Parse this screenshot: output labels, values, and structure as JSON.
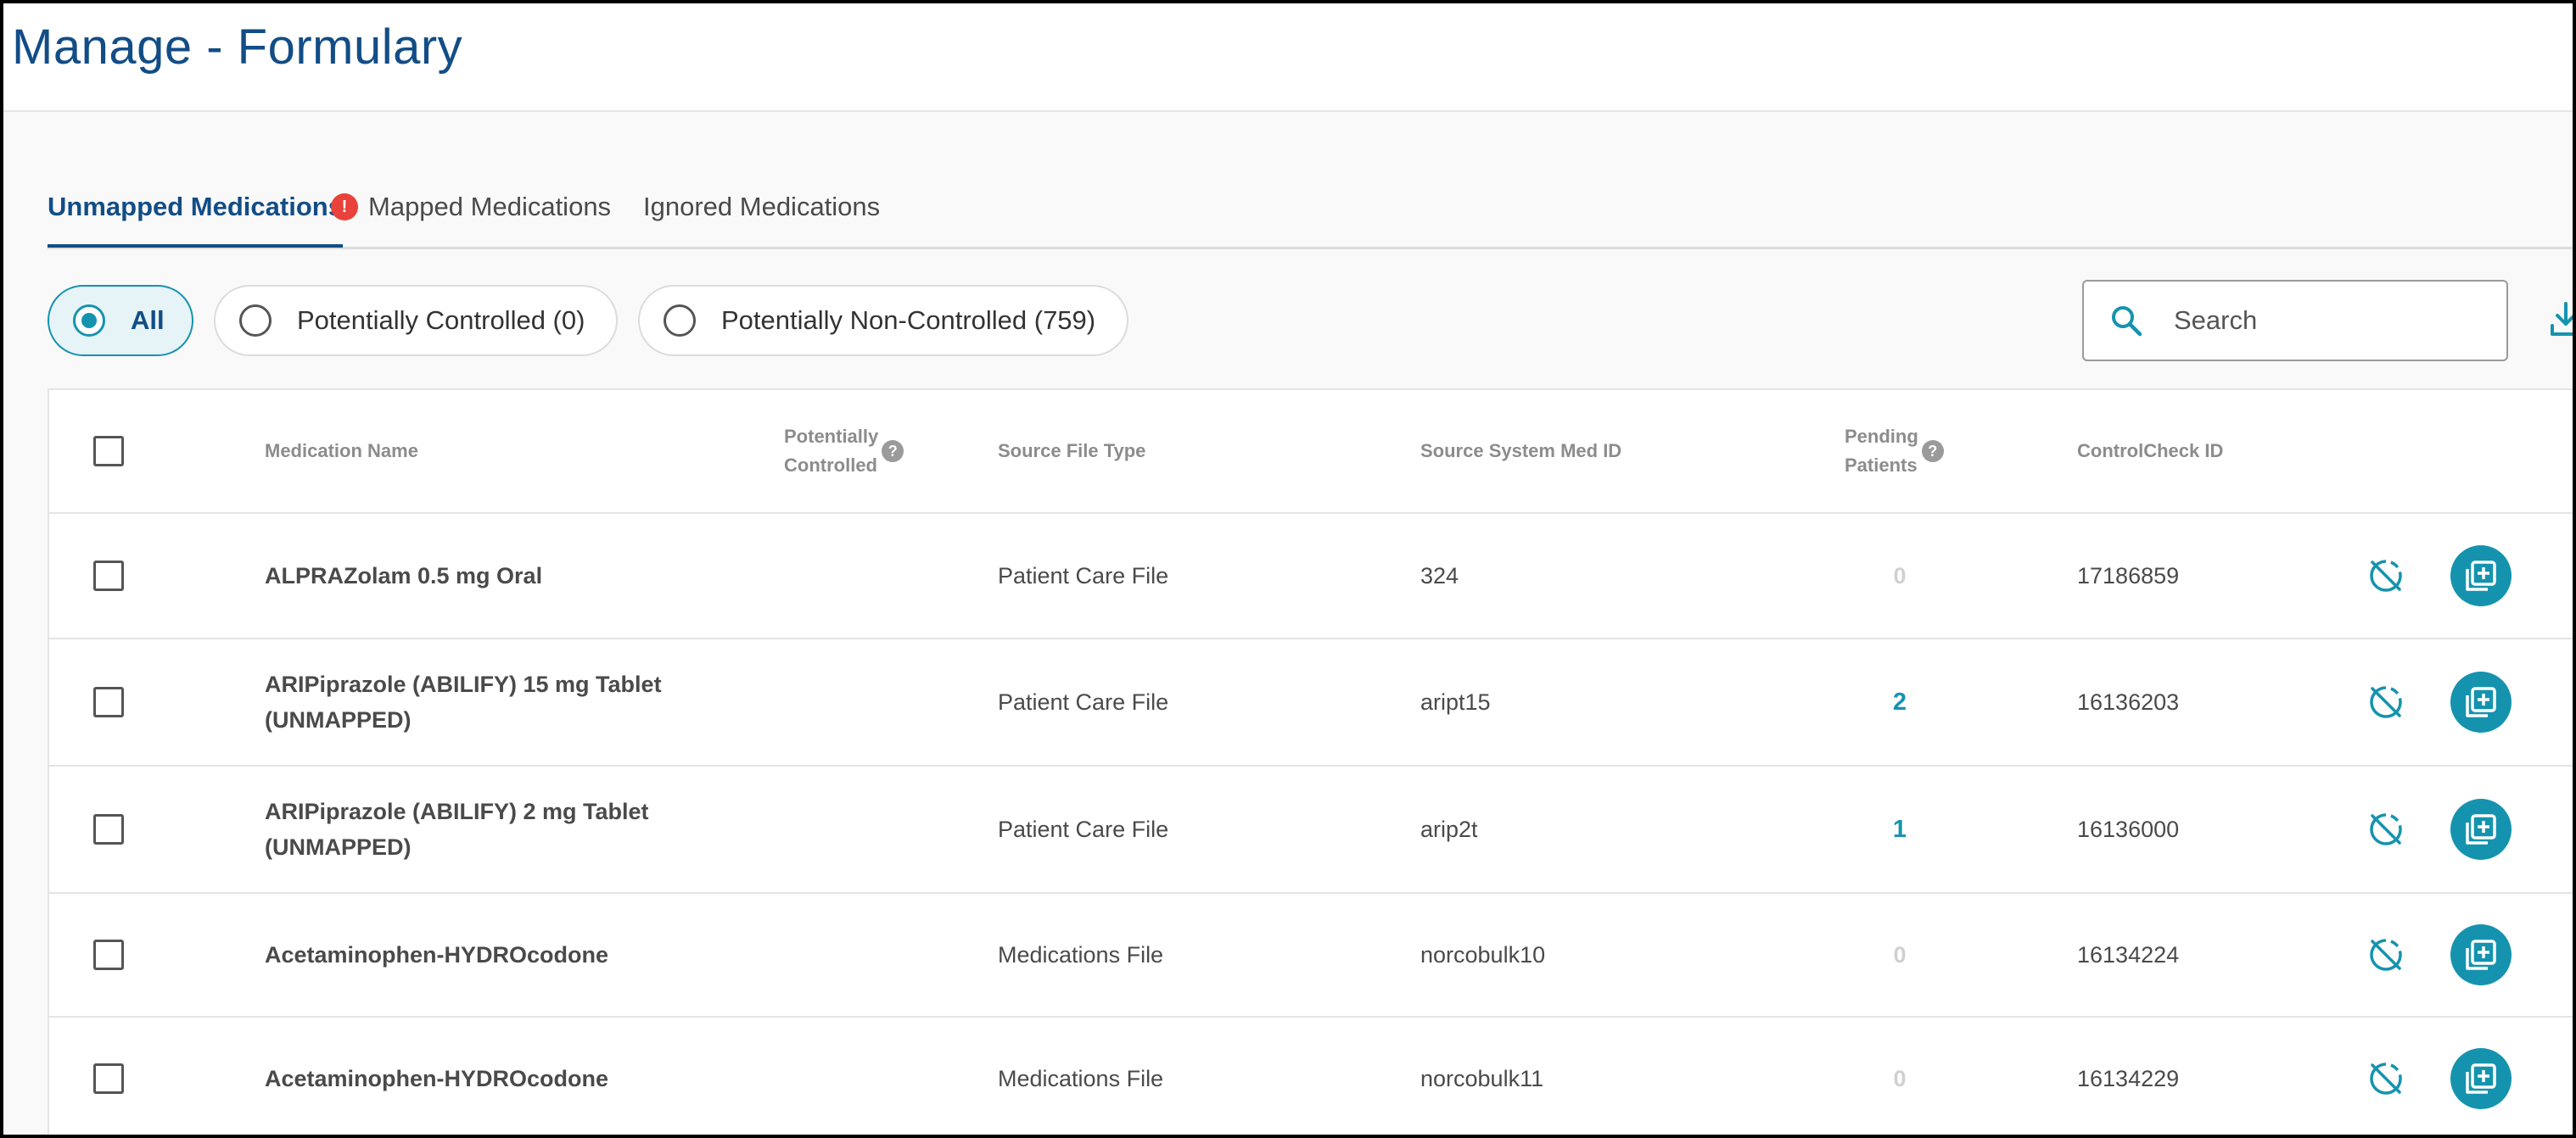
{
  "page": {
    "title": "Manage - Formulary"
  },
  "tabs": [
    {
      "label": "Unmapped Medications",
      "active": true,
      "alert": "!"
    },
    {
      "label": "Mapped Medications",
      "active": false
    },
    {
      "label": "Ignored Medications",
      "active": false
    }
  ],
  "filters": [
    {
      "label": "All",
      "selected": true
    },
    {
      "label": "Potentially Controlled (0)",
      "selected": false
    },
    {
      "label": "Potentially Non-Controlled (759)",
      "selected": false
    }
  ],
  "search": {
    "placeholder": "Search",
    "value": ""
  },
  "table": {
    "headers": {
      "medication_name": "Medication Name",
      "potentially_controlled_1": "Potentially",
      "potentially_controlled_2": "Controlled",
      "source_file_type": "Source File Type",
      "source_system_med_id": "Source System Med ID",
      "pending_patients_1": "Pending",
      "pending_patients_2": "Patients",
      "controlcheck_id": "ControlCheck ID",
      "help_glyph": "?"
    },
    "rows": [
      {
        "name_line1": "ALPRAZolam 0.5 mg Oral",
        "name_line2": "",
        "source_file_type": "Patient Care File",
        "source_med_id": "324",
        "pending": "0",
        "controlcheck_id": "17186859"
      },
      {
        "name_line1": "ARIPiprazole (ABILIFY) 15 mg Tablet",
        "name_line2": "(UNMAPPED)",
        "source_file_type": "Patient Care File",
        "source_med_id": "aript15",
        "pending": "2",
        "controlcheck_id": "16136203"
      },
      {
        "name_line1": "ARIPiprazole (ABILIFY) 2 mg Tablet",
        "name_line2": "(UNMAPPED)",
        "source_file_type": "Patient Care File",
        "source_med_id": "arip2t",
        "pending": "1",
        "controlcheck_id": "16136000"
      },
      {
        "name_line1": "Acetaminophen-HYDROcodone",
        "name_line2": "",
        "source_file_type": "Medications File",
        "source_med_id": "norcobulk10",
        "pending": "0",
        "controlcheck_id": "16134224"
      },
      {
        "name_line1": "Acetaminophen-HYDROcodone",
        "name_line2": "",
        "source_file_type": "Medications File",
        "source_med_id": "norcobulk11",
        "pending": "0",
        "controlcheck_id": "16134229"
      }
    ],
    "row_actions": {
      "ignore_icon": "ignore-icon",
      "map_icon": "add-mapping-icon"
    }
  },
  "colors": {
    "title": "#124d86",
    "accent": "#1593ae",
    "alert": "#e8423a"
  }
}
